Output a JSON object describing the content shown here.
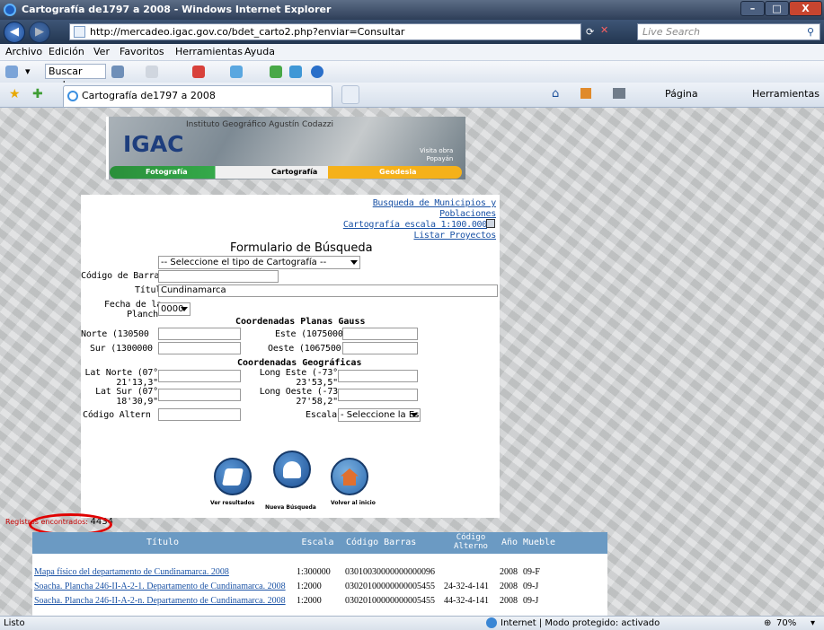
{
  "window": {
    "title": "Cartografía de1797 a 2008 - Windows Internet Explorer",
    "min_label": "–",
    "max_label": "□",
    "close_label": "X"
  },
  "address": {
    "url": "http://mercadeo.igac.gov.co/bdet_carto2.php?enviar=Consultar",
    "search_placeholder": "Live Search",
    "back_label": "◀",
    "forward_label": "▶"
  },
  "menu": [
    "Archivo",
    "Edición",
    "Ver",
    "Favoritos",
    "Herramientas",
    "Ayuda"
  ],
  "linkbar": {
    "search_web": "Buscar web.."
  },
  "tab": {
    "title": "Cartografía de1797 a 2008"
  },
  "commandbar": {
    "page": "Página",
    "tools": "Herramientas"
  },
  "banner": {
    "logo": "IGAC",
    "institute": "Instituto Geográfico Agustín Codazzi",
    "visit_line1": "Visita obra",
    "visit_line2": "Popayán",
    "nav": [
      "Fotografía",
      "Cartografía",
      "Geodesia"
    ]
  },
  "links": {
    "municipios": "Busqueda de Municipios y Poblaciones",
    "escala": "Cartografía escala 1:100.000",
    "proyectos": "Listar Proyectos"
  },
  "form": {
    "heading": "Formulario de Búsqueda",
    "tipo_select": "-- Seleccione el tipo de Cartografía --",
    "codigo_barra_label": "Código de Barra",
    "titulo_label": "Título",
    "titulo_value": "Cundinamarca",
    "fecha_label_1": "Fecha de la",
    "fecha_label_2": "Planch",
    "fecha_select": "0000",
    "gauss_heading": "Coordenadas Planas Gauss",
    "norte_label": "Norte (130500",
    "este_label": "Este (1075000",
    "sur_label": "Sur (1300000",
    "oeste_label": "Oeste (1067500",
    "geo_heading": "Coordenadas Geográficas",
    "lat_norte_1": "Lat Norte (07°",
    "lat_norte_2": "21'13,3\"",
    "long_este_1": "Long Este (-73°",
    "long_este_2": "23'53,5\"",
    "lat_sur_1": "Lat Sur (07°",
    "lat_sur_2": "18'30,9\"",
    "long_oeste_1": "Long Oeste (-73",
    "long_oeste_2": "27'58,2\"",
    "codigo_alterno_label": "Código Altern",
    "escala_label": "Escala",
    "escala_select": "- Seleccione la Escala -"
  },
  "actions": {
    "ver": "Ver resultados",
    "nueva": "Nueva Búsqueda",
    "volver": "Volver al inicio"
  },
  "results": {
    "label": "Registros encontrados:",
    "count": "4434"
  },
  "table": {
    "headers": [
      "Título",
      "Escala",
      "Código Barras",
      "Código Alterno",
      "Año",
      "Mueble"
    ],
    "rows": [
      [
        "Mapa físico del departamento de Cundinamarca. 2008",
        "1:300000",
        "03010030000000000096",
        "",
        "2008",
        "09-F"
      ],
      [
        "Soacha. Plancha 246-II-A-2-1. Departamento de Cundinamarca. 2008",
        "1:2000",
        "03020100000000005455",
        "24-32-4-141",
        "2008",
        "09-J"
      ],
      [
        "Soacha. Plancha 246-II-A-2-n. Departamento de Cundinamarca. 2008",
        "1:2000",
        "03020100000000005455",
        "44-32-4-141",
        "2008",
        "09-J"
      ]
    ]
  },
  "status": {
    "left": "Listo",
    "zone": "Internet | Modo protegido: activado",
    "zoom": "70%"
  }
}
